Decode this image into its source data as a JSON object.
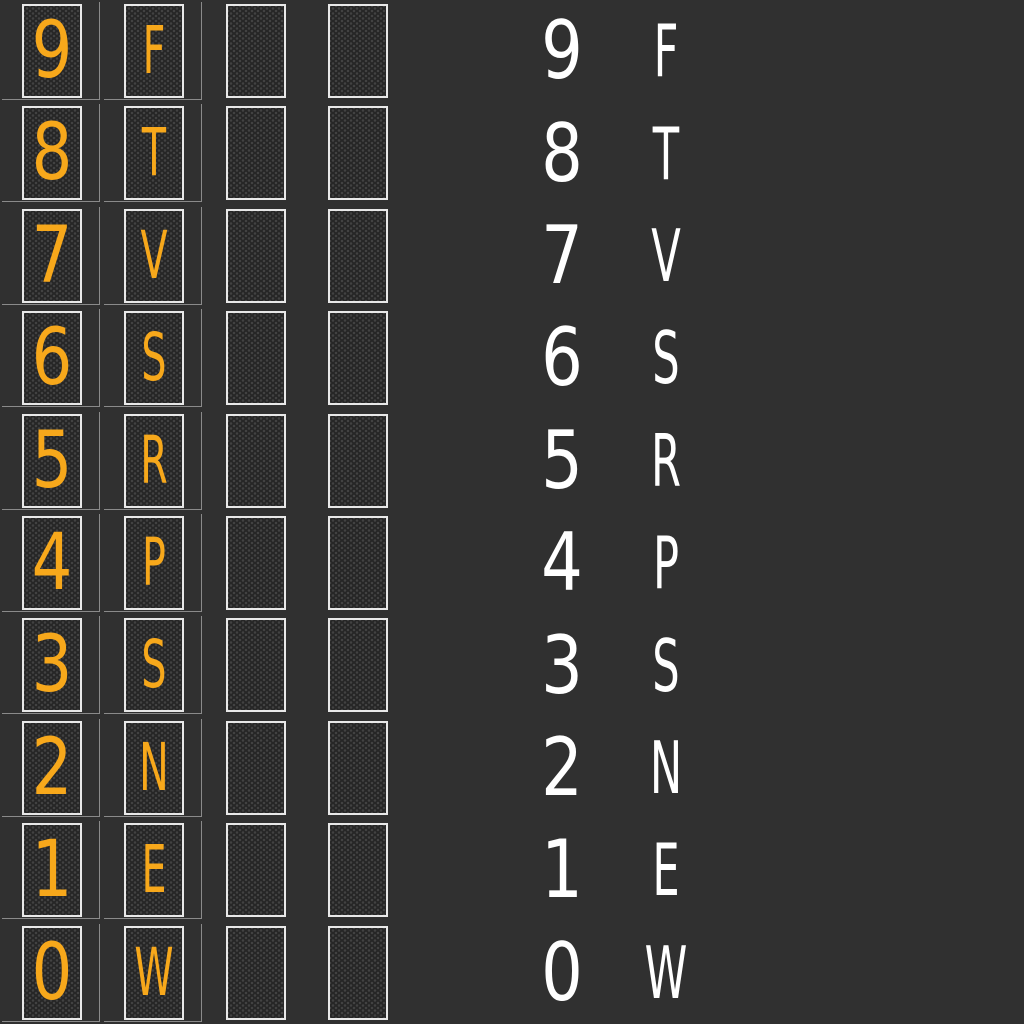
{
  "colors": {
    "background": "#303030",
    "tile_fill": "#262626",
    "tile_border": "#e8e8e8",
    "glyph_amber": "#f7a81b",
    "preview_text": "#ffffff"
  },
  "rows": [
    {
      "digit": "9",
      "letter": "F"
    },
    {
      "digit": "8",
      "letter": "T"
    },
    {
      "digit": "7",
      "letter": "V"
    },
    {
      "digit": "6",
      "letter": "S"
    },
    {
      "digit": "5",
      "letter": "R"
    },
    {
      "digit": "4",
      "letter": "P"
    },
    {
      "digit": "3",
      "letter": "S"
    },
    {
      "digit": "2",
      "letter": "N"
    },
    {
      "digit": "1",
      "letter": "E"
    },
    {
      "digit": "0",
      "letter": "W"
    }
  ],
  "blank_tile_columns": 2
}
